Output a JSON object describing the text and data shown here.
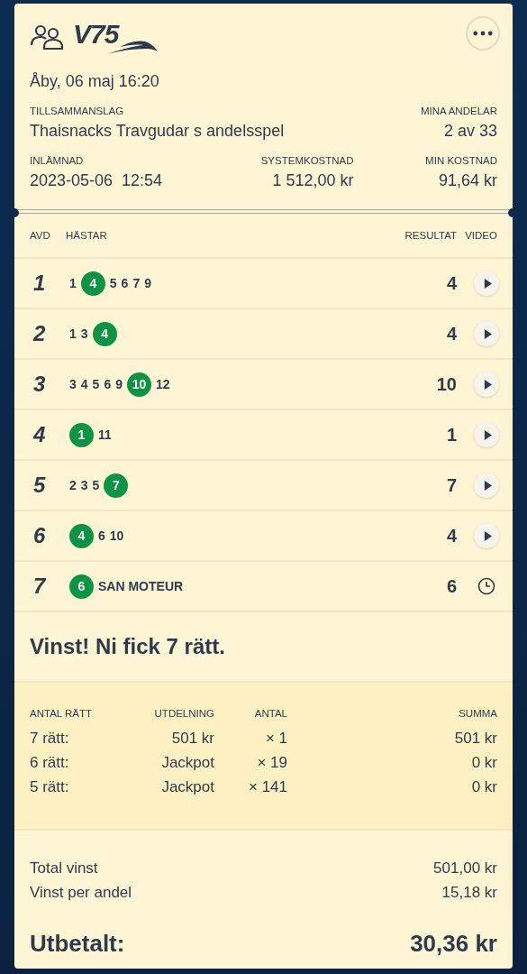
{
  "header": {
    "logo": "V75",
    "date": "Åby, 06 maj 16:20",
    "info": [
      {
        "label": "TILLSAMMANSLAG",
        "value": "Thaisnacks Travgudar s andelsspel"
      },
      {
        "label": "MINA ANDELAR",
        "value": "2 av 33"
      }
    ],
    "info2": [
      {
        "label": "INLÄMNAD",
        "value": "2023-05-06  12:54"
      },
      {
        "label": "SYSTEMKOSTNAD",
        "value": "1 512,00 kr"
      },
      {
        "label": "MIN KOSTNAD",
        "value": "91,64 kr"
      }
    ]
  },
  "legs": {
    "columns": [
      "AVD",
      "HÄSTAR",
      "RESULTAT",
      "VIDEO"
    ],
    "rows": [
      {
        "avd": "1",
        "horses": [
          {
            "text": "1",
            "selected": false
          },
          {
            "text": "4",
            "selected": true
          },
          {
            "text": "5",
            "selected": false
          },
          {
            "text": "6",
            "selected": false
          },
          {
            "text": "7",
            "selected": false
          },
          {
            "text": "9",
            "selected": false
          }
        ],
        "result": "4",
        "video": {
          "kind": "play"
        }
      },
      {
        "avd": "2",
        "horses": [
          {
            "text": "1",
            "selected": false
          },
          {
            "text": "3",
            "selected": false
          },
          {
            "text": "4",
            "selected": true
          }
        ],
        "result": "4",
        "video": {
          "kind": "play"
        }
      },
      {
        "avd": "3",
        "horses": [
          {
            "text": "3",
            "selected": false
          },
          {
            "text": "4",
            "selected": false
          },
          {
            "text": "5",
            "selected": false
          },
          {
            "text": "6",
            "selected": false
          },
          {
            "text": "9",
            "selected": false
          },
          {
            "text": "10",
            "selected": true
          },
          {
            "text": "12",
            "selected": false
          }
        ],
        "result": "10",
        "video": {
          "kind": "play"
        }
      },
      {
        "avd": "4",
        "horses": [
          {
            "text": "1",
            "selected": true
          },
          {
            "text": "11",
            "selected": false
          }
        ],
        "result": "1",
        "video": {
          "kind": "play"
        }
      },
      {
        "avd": "5",
        "horses": [
          {
            "text": "2",
            "selected": false
          },
          {
            "text": "3",
            "selected": false
          },
          {
            "text": "5",
            "selected": false
          },
          {
            "text": "7",
            "selected": true
          }
        ],
        "result": "7",
        "video": {
          "kind": "play"
        }
      },
      {
        "avd": "6",
        "horses": [
          {
            "text": "4",
            "selected": true
          },
          {
            "text": "6",
            "selected": false
          },
          {
            "text": "10",
            "selected": false
          }
        ],
        "result": "4",
        "video": {
          "kind": "play"
        }
      },
      {
        "avd": "7",
        "horses": [
          {
            "text": "6",
            "selected": true
          },
          {
            "text": "SAN MOTEUR",
            "selected": false
          }
        ],
        "result": "6",
        "video": {
          "kind": "pending"
        }
      }
    ]
  },
  "win_message": "Vinst! Ni fick 7 rätt.",
  "payout": {
    "columns": [
      "ANTAL RÄTT",
      "UTDELNING",
      "ANTAL",
      "SUMMA"
    ],
    "rows": [
      [
        "7 rätt:",
        "501 kr",
        "× 1",
        "501 kr"
      ],
      [
        "6 rätt:",
        "Jackpot",
        "× 19",
        "0 kr"
      ],
      [
        "5 rätt:",
        "Jackpot",
        "× 141",
        "0 kr"
      ]
    ]
  },
  "totals": [
    {
      "label": "Total vinst",
      "value": "501,00 kr"
    },
    {
      "label": "Vinst per andel",
      "value": "15,18 kr"
    }
  ],
  "paid": {
    "label": "Utbetalt:",
    "value": "30,36 kr"
  }
}
